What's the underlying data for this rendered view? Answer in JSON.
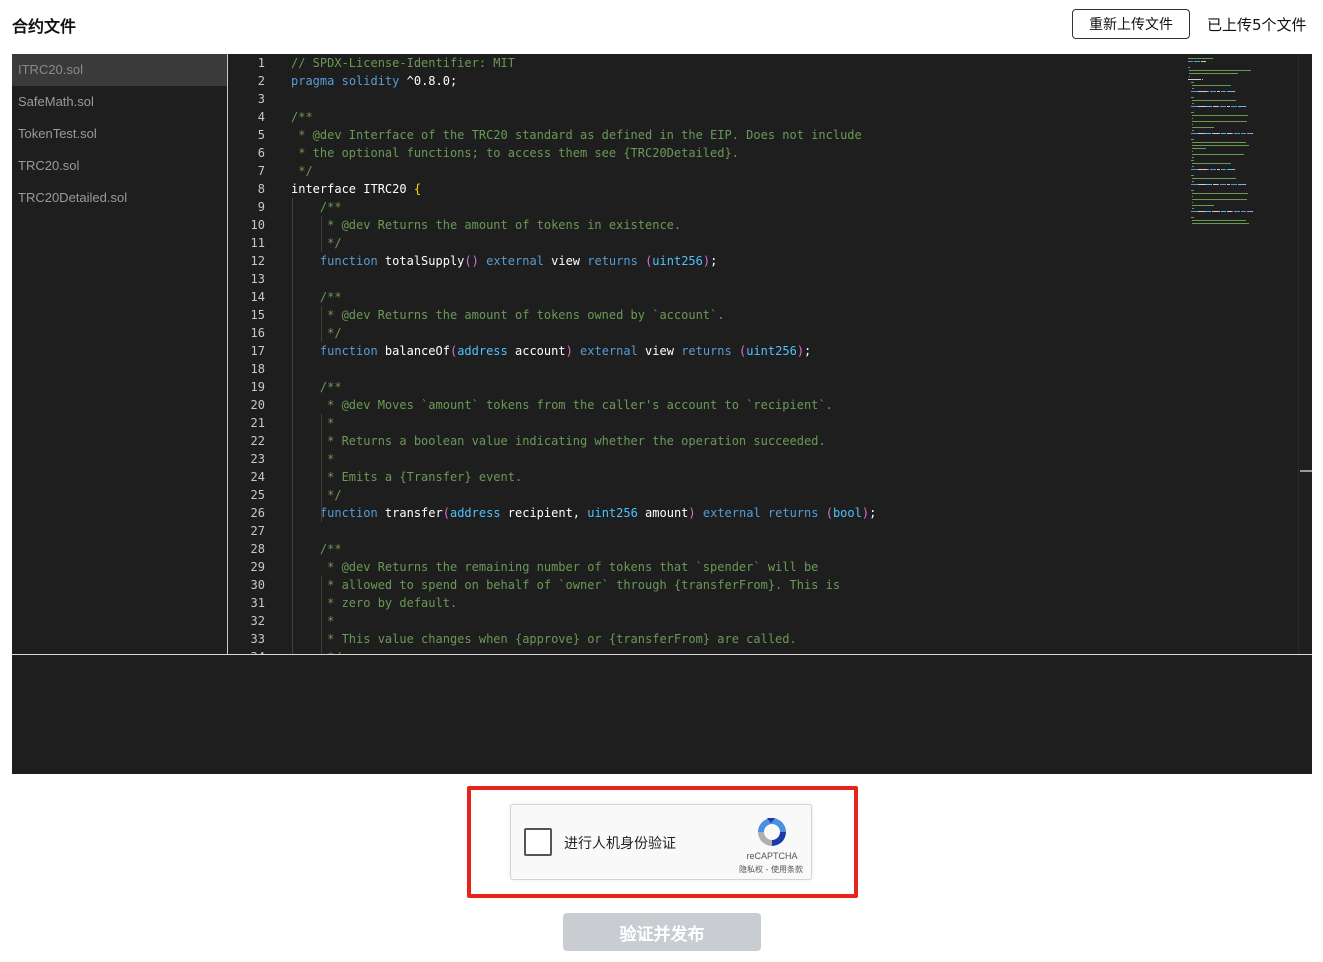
{
  "header": {
    "title": "合约文件",
    "reupload_label": "重新上传文件",
    "upload_status": "已上传5个文件"
  },
  "files": [
    "ITRC20.sol",
    "SafeMath.sol",
    "TokenTest.sol",
    "TRC20.sol",
    "TRC20Detailed.sol"
  ],
  "active_file": "ITRC20.sol",
  "code_lines": [
    [
      [
        "cm",
        "// SPDX-License-Identifier: MIT"
      ]
    ],
    [
      [
        "kw",
        "pragma"
      ],
      [
        "tx",
        " "
      ],
      [
        "kw",
        "solidity"
      ],
      [
        "tx",
        " ^0.8.0;"
      ]
    ],
    [],
    [
      [
        "cm",
        "/**"
      ]
    ],
    [
      [
        "cm",
        " * @dev Interface of the TRC20 standard as defined in the EIP. Does not include"
      ]
    ],
    [
      [
        "cm",
        " * the optional functions; to access them see {TRC20Detailed}."
      ]
    ],
    [
      [
        "cm",
        " */"
      ]
    ],
    [
      [
        "tx",
        "interface ITRC20 "
      ],
      [
        "br",
        "{"
      ]
    ],
    [
      [
        "cm",
        "    /**"
      ]
    ],
    [
      [
        "cm",
        "     * @dev Returns the amount of tokens in existence."
      ]
    ],
    [
      [
        "cm",
        "     */"
      ]
    ],
    [
      [
        "tx",
        "    "
      ],
      [
        "kw",
        "function"
      ],
      [
        "tx",
        " totalSupply"
      ],
      [
        "pr",
        "()"
      ],
      [
        "tx",
        " "
      ],
      [
        "kw",
        "external"
      ],
      [
        "tx",
        " view "
      ],
      [
        "kw",
        "returns"
      ],
      [
        "tx",
        " "
      ],
      [
        "pr",
        "("
      ],
      [
        "ty",
        "uint256"
      ],
      [
        "pr",
        ")"
      ],
      [
        "tx",
        ";"
      ]
    ],
    [],
    [
      [
        "cm",
        "    /**"
      ]
    ],
    [
      [
        "cm",
        "     * @dev Returns the amount of tokens owned by `account`."
      ]
    ],
    [
      [
        "cm",
        "     */"
      ]
    ],
    [
      [
        "tx",
        "    "
      ],
      [
        "kw",
        "function"
      ],
      [
        "tx",
        " balanceOf"
      ],
      [
        "pr",
        "("
      ],
      [
        "ty",
        "address"
      ],
      [
        "tx",
        " account"
      ],
      [
        "pr",
        ")"
      ],
      [
        "tx",
        " "
      ],
      [
        "kw",
        "external"
      ],
      [
        "tx",
        " view "
      ],
      [
        "kw",
        "returns"
      ],
      [
        "tx",
        " "
      ],
      [
        "pr",
        "("
      ],
      [
        "ty",
        "uint256"
      ],
      [
        "pr",
        ")"
      ],
      [
        "tx",
        ";"
      ]
    ],
    [],
    [
      [
        "cm",
        "    /**"
      ]
    ],
    [
      [
        "cm",
        "     * @dev Moves `amount` tokens from the caller's account to `recipient`."
      ]
    ],
    [
      [
        "cm",
        "     *"
      ]
    ],
    [
      [
        "cm",
        "     * Returns a boolean value indicating whether the operation succeeded."
      ]
    ],
    [
      [
        "cm",
        "     *"
      ]
    ],
    [
      [
        "cm",
        "     * Emits a {Transfer} event."
      ]
    ],
    [
      [
        "cm",
        "     */"
      ]
    ],
    [
      [
        "tx",
        "    "
      ],
      [
        "kw",
        "function"
      ],
      [
        "tx",
        " transfer"
      ],
      [
        "pr",
        "("
      ],
      [
        "ty",
        "address"
      ],
      [
        "tx",
        " recipient, "
      ],
      [
        "ty",
        "uint256"
      ],
      [
        "tx",
        " amount"
      ],
      [
        "pr",
        ")"
      ],
      [
        "tx",
        " "
      ],
      [
        "kw",
        "external"
      ],
      [
        "tx",
        " "
      ],
      [
        "kw",
        "returns"
      ],
      [
        "tx",
        " "
      ],
      [
        "pr",
        "("
      ],
      [
        "ty",
        "bool"
      ],
      [
        "pr",
        ")"
      ],
      [
        "tx",
        ";"
      ]
    ],
    [],
    [
      [
        "cm",
        "    /**"
      ]
    ],
    [
      [
        "cm",
        "     * @dev Returns the remaining number of tokens that `spender` will be"
      ]
    ],
    [
      [
        "cm",
        "     * allowed to spend on behalf of `owner` through {transferFrom}. This is"
      ]
    ],
    [
      [
        "cm",
        "     * zero by default."
      ]
    ],
    [
      [
        "cm",
        "     *"
      ]
    ],
    [
      [
        "cm",
        "     * This value changes when {approve} or {transferFrom} are called."
      ]
    ],
    [
      [
        "cm",
        "     */"
      ]
    ]
  ],
  "colors": {
    "editor_bg": "#1e1e1e",
    "comment": "#6a9955",
    "keyword": "#569cd6",
    "type": "#4fc1ff",
    "paren": "#da70d6",
    "brace": "#ffd700",
    "highlight_border": "#e5251b",
    "button_disabled": "#c9ccd1"
  },
  "captcha": {
    "label": "进行人机身份验证",
    "brand": "reCAPTCHA",
    "links": "隐私权 - 使用条款",
    "icon": "recaptcha-icon"
  },
  "submit": {
    "label": "验证并发布",
    "disabled": true
  }
}
